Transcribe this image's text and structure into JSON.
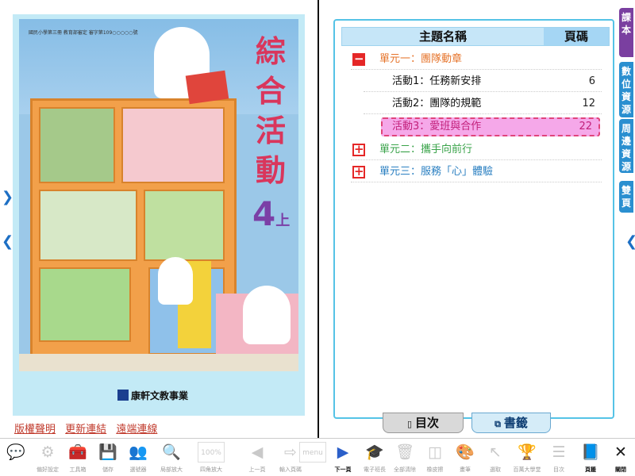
{
  "cover": {
    "header_line": "國民小學第三冊  教育部審定  審字第109○○○○○號",
    "title": "綜合活動",
    "grade_num": "4",
    "grade_sup": "上",
    "publisher": "康軒文教事業"
  },
  "links": [
    "版權聲明",
    "更新連結",
    "遠端連線"
  ],
  "nav": {
    "left_arrow": "❮",
    "right_arrow": "❮",
    "left_inner": "❯"
  },
  "toc": {
    "header_title": "主題名稱",
    "header_page": "頁碼",
    "units": [
      {
        "label": "單元一：團隊動章",
        "expanded": true,
        "color": "#e6742b",
        "icon": "−"
      },
      {
        "label": "單元二：攜手向前行",
        "expanded": false,
        "color": "#3aa34a",
        "icon": "+"
      },
      {
        "label": "單元三：服務「心」體驗",
        "expanded": false,
        "color": "#2a7fc1",
        "icon": "+"
      }
    ],
    "activities": [
      {
        "label": "活動1：任務新安排",
        "page": "6"
      },
      {
        "label": "活動2：團隊的規範",
        "page": "12"
      },
      {
        "label": "活動3：愛班與合作",
        "page": "22",
        "selected": true
      }
    ]
  },
  "bottom_tabs": {
    "toc": "目次",
    "bookmark": "書籤"
  },
  "side_tabs": [
    {
      "label": "課本",
      "color": "#7a3fa0"
    },
    {
      "label": "數位資源",
      "color": "#2a8fd0"
    },
    {
      "label": "周邊資源",
      "color": "#2a8fd0"
    },
    {
      "label": "雙頁",
      "color": "#2a8fd0"
    }
  ],
  "toolbar": [
    {
      "label": "",
      "icon": "chat-icon",
      "glyph": "💬"
    },
    {
      "label": "偏好設定",
      "icon": "gear-icon",
      "glyph": "⚙"
    },
    {
      "label": "工具箱",
      "icon": "toolbox-icon",
      "glyph": "🧰"
    },
    {
      "label": "儲存",
      "icon": "save-icon",
      "glyph": "💾"
    },
    {
      "label": "選號器",
      "icon": "picker-icon",
      "glyph": "👥"
    },
    {
      "label": "局部放大",
      "icon": "magnify-icon",
      "glyph": "🔍"
    },
    {
      "label": "四角放大",
      "icon": "zoom-100-icon",
      "glyph": "100%"
    },
    {
      "label": "上一頁",
      "icon": "prev-page-icon",
      "glyph": "◀"
    },
    {
      "label": "輸入頁碼",
      "icon": "page-input-icon",
      "glyph": "⇨"
    },
    {
      "label": "",
      "icon": "menu-icon",
      "glyph": "menu"
    },
    {
      "label": "下一頁",
      "icon": "next-page-icon",
      "glyph": "▶",
      "active": true
    },
    {
      "label": "電子班長",
      "icon": "cap-icon",
      "glyph": "🎓"
    },
    {
      "label": "全部清除",
      "icon": "trash-icon",
      "glyph": "🗑"
    },
    {
      "label": "橡皮擦",
      "icon": "eraser-icon",
      "glyph": "◫"
    },
    {
      "label": "畫筆",
      "icon": "palette-icon",
      "glyph": "🎨"
    },
    {
      "label": "選取",
      "icon": "cursor-icon",
      "glyph": "↖"
    },
    {
      "label": "百萬大學堂",
      "icon": "trophy-icon",
      "glyph": "🏆"
    },
    {
      "label": "目次",
      "icon": "toc-icon",
      "glyph": "☰"
    },
    {
      "label": "頁籤",
      "icon": "bookmark-icon",
      "glyph": "📘",
      "active": true
    },
    {
      "label": "關閉",
      "icon": "close-icon",
      "glyph": "✕",
      "active": true
    }
  ]
}
